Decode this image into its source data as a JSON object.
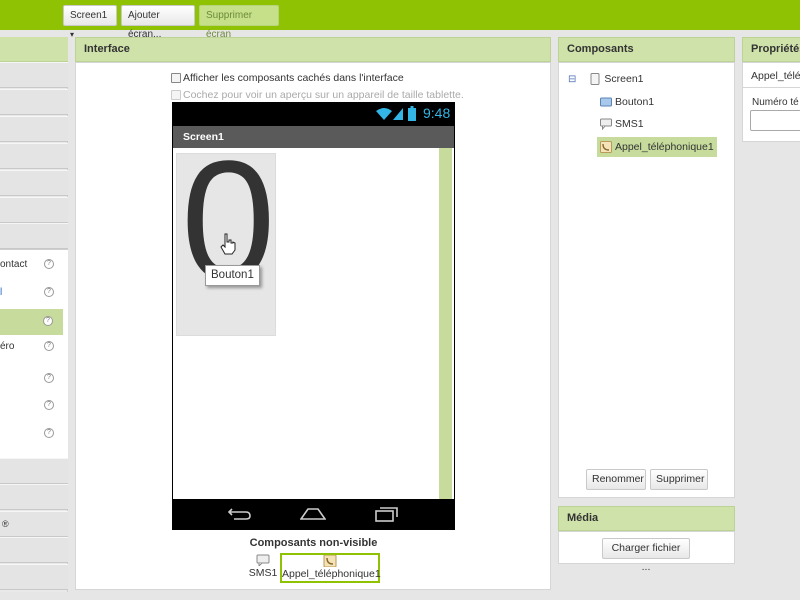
{
  "toolbar": {
    "screen_select": "Screen1",
    "screen_caret": "▾",
    "add_screen": "Ajouter écran...",
    "remove_screen": "Supprimer écran"
  },
  "palette": {
    "items": [
      "ontact",
      "l",
      "",
      "éro",
      "",
      "",
      ""
    ],
    "extra_label": "®",
    "help_glyph": "?"
  },
  "viewer": {
    "title": "Interface",
    "show_hidden": "Afficher les composants cachés dans l'interface",
    "tablet_preview": "Cochez pour voir un aperçu sur un appareil de taille tablette.",
    "clock": "9:48",
    "screen_title": "Screen1",
    "button_text": "0",
    "tooltip": "Bouton1",
    "nonvisible_title": "Composants non-visible",
    "nonvisible": [
      "SMS1",
      "Appel_téléphonique1"
    ]
  },
  "components": {
    "title": "Composants",
    "collapse_glyph": "⊟",
    "tree": [
      "Screen1",
      "Bouton1",
      "SMS1",
      "Appel_téléphonique1"
    ],
    "rename": "Renommer",
    "delete": "Supprimer"
  },
  "media": {
    "title": "Média",
    "upload": "Charger fichier ..."
  },
  "properties": {
    "title": "Propriétés",
    "component": "Appel_télé",
    "field_label": "Numéro té",
    "field_value": ""
  },
  "colors": {
    "accent": "#8fc202",
    "header": "#cfe2a9",
    "selection": "#c6db9c"
  }
}
